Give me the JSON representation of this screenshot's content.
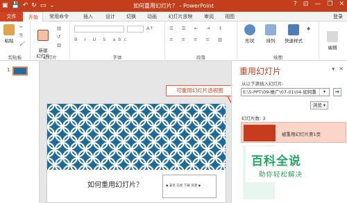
{
  "window": {
    "title": "如何重用幻灯片？ - PowerPoint",
    "controls": [
      "?",
      "⊡",
      "—",
      "❐",
      "✕"
    ]
  },
  "tabs": [
    "文件",
    "开始",
    "常用命令",
    "插入",
    "设计",
    "切换",
    "动画",
    "幻灯片放映",
    "审阅",
    "视图"
  ],
  "login": "登录",
  "ribbon": {
    "clipboard": {
      "paste": "粘贴",
      "label": "剪贴板"
    },
    "slides": {
      "new_slide": "新建\n幻灯片",
      "label": "幻灯片"
    },
    "font": {
      "label": "字体"
    },
    "paragraph": {
      "label": "段落"
    },
    "drawing": {
      "shapes": "形状",
      "arrange": "排列",
      "quick_styles": "快速样式",
      "label": "绘图"
    },
    "editing": {
      "edit": "编辑"
    }
  },
  "thumbnails": {
    "slide_number": "1"
  },
  "slide": {
    "title": "如何重用幻灯片？",
    "subtitle_text": "◆ 安装 已经 下载 资源 ◆"
  },
  "callout": "可重用幻灯片透视图",
  "taskpane": {
    "title": "重用幻灯片",
    "source_label": "从以下源插入幻灯片:",
    "path_value": "E:\\5-PPT\\09-推广\\07-01\\04-如何重",
    "browse": "浏览",
    "count": "幻灯片数: 3",
    "item1_label": "被重用幻灯片第1页"
  },
  "watermark": {
    "main": "百科全说",
    "sub": "助你轻松解决"
  },
  "colors": {
    "accent": "#c43e1c",
    "pattern": "#1e6a99",
    "watermark": "#23a863"
  }
}
